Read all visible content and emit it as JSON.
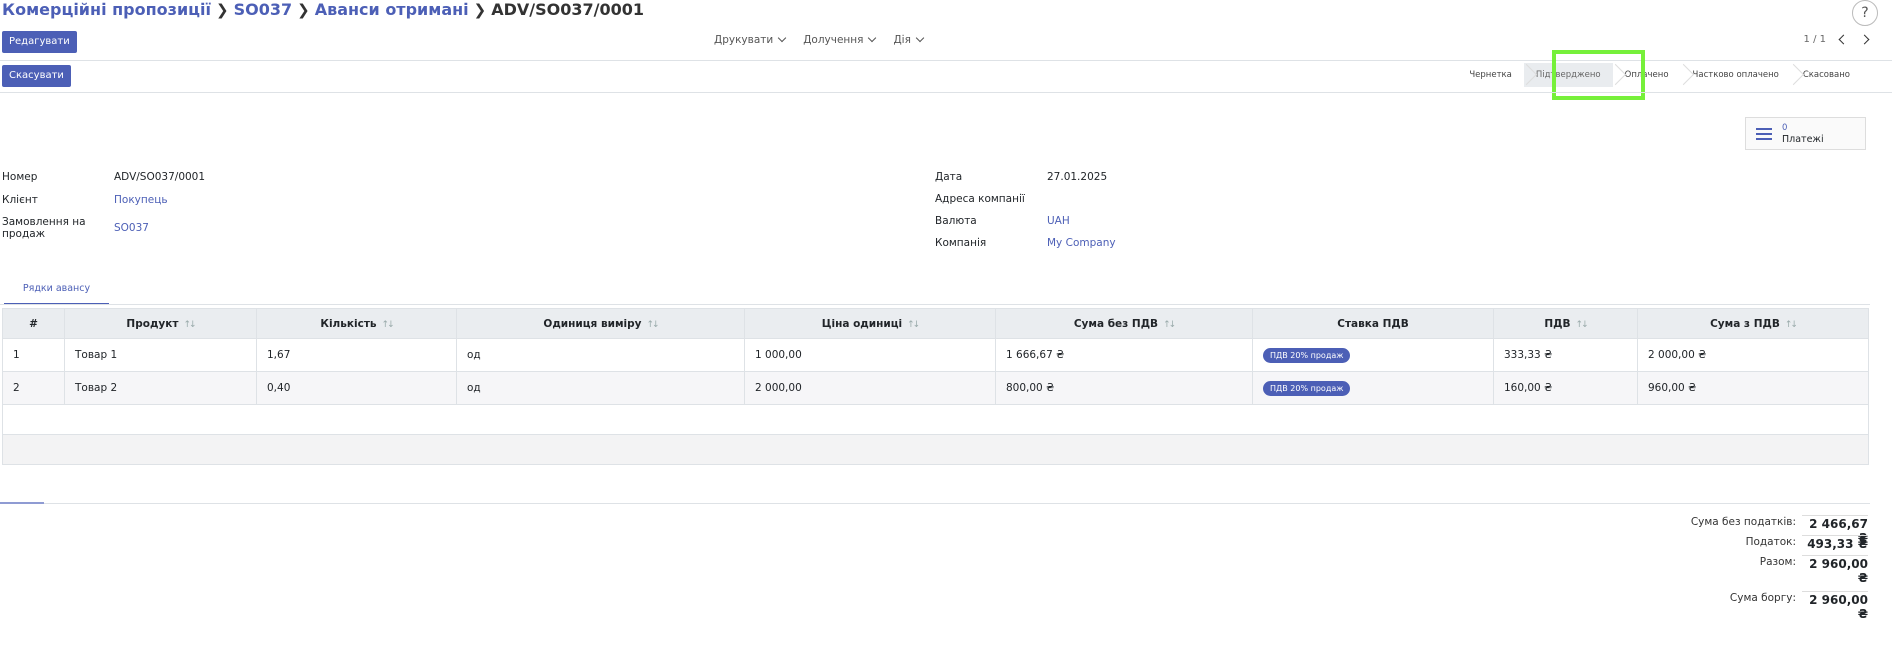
{
  "breadcrumb": [
    {
      "label": "Комерційні пропозиції"
    },
    {
      "label": "SO037"
    },
    {
      "label": "Аванси отримані"
    }
  ],
  "breadcrumb_current": "ADV/SO037/0001",
  "help_label": "?",
  "buttons": {
    "edit": "Редагувати",
    "cancel": "Скасувати"
  },
  "menus": [
    "Друкувати",
    "Долучення",
    "Дія"
  ],
  "pager": "1 / 1",
  "stages": [
    "Чернетка",
    "Підтверджено",
    "Оплачено",
    "Частково оплачено",
    "Скасовано"
  ],
  "active_stage": "Підтверджено",
  "smart_button": {
    "count": "0",
    "label": "Платежі"
  },
  "fields_left": [
    {
      "label": "Номер",
      "value": "ADV/SO037/0001"
    },
    {
      "label": "Клієнт",
      "value": "Покупець"
    },
    {
      "label": "Замовлення на продаж",
      "value": "SO037"
    }
  ],
  "fields_right": [
    {
      "label": "Дата",
      "value": "27.01.2025"
    },
    {
      "label": "Адреса компанії",
      "value": ""
    },
    {
      "label": "Валюта",
      "value": "UAH"
    },
    {
      "label": "Компанія",
      "value": "My Company"
    }
  ],
  "tab_label": "Рядки авансу",
  "table": {
    "columns": [
      "#",
      "Продукт",
      "Кількість",
      "Одиниця виміру",
      "Ціна одиниці",
      "Сума без ПДВ",
      "Ставка ПДВ",
      "ПДВ",
      "Сума з ПДВ"
    ],
    "sort_glyph": "↑↓",
    "rows": [
      {
        "num": "1",
        "product": "Товар 1",
        "qty": "1,67",
        "uom": "од",
        "price": "1 000,00",
        "subtotal": "1 666,67 ₴",
        "tax": "ПДВ 20% продаж",
        "vat": "333,33 ₴",
        "total": "2 000,00 ₴"
      },
      {
        "num": "2",
        "product": "Товар 2",
        "qty": "0,40",
        "uom": "од",
        "price": "2 000,00",
        "subtotal": "800,00 ₴",
        "tax": "ПДВ 20% продаж",
        "vat": "160,00 ₴",
        "total": "960,00 ₴"
      }
    ]
  },
  "totals": {
    "untaxed_label": "Сума без податків:",
    "untaxed": "2 466,67 ₴",
    "tax_label": "Податок:",
    "tax": "493,33 ₴",
    "total_label": "Разом:",
    "total": "2 960,00 ₴",
    "due_label": "Сума боргу:",
    "due": "2 960,00 ₴"
  },
  "colors": {
    "accent": "#4c5fb6",
    "highlight": "#76f03a"
  }
}
